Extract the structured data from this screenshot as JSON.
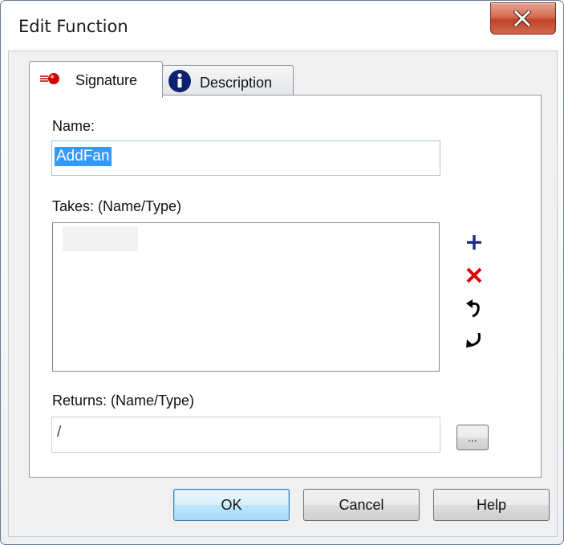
{
  "window": {
    "title": "Edit Function",
    "close_label": "Close"
  },
  "tabs": [
    {
      "label": "Signature",
      "icon": "red-ball-icon",
      "active": true
    },
    {
      "label": "Description",
      "icon": "info-icon",
      "active": false
    }
  ],
  "signature": {
    "name_label": "Name:",
    "name_value": "AddFan",
    "takes_label": "Takes: (Name/Type)",
    "takes_items": [],
    "returns_label": "Returns: (Name/Type)",
    "returns_value": "/",
    "browse_label": "...",
    "list_actions": [
      {
        "name": "add-icon",
        "color": "#1f2d8a"
      },
      {
        "name": "delete-icon",
        "color": "#e00000"
      },
      {
        "name": "move-up-icon",
        "color": "#000000"
      },
      {
        "name": "move-down-icon",
        "color": "#000000"
      }
    ]
  },
  "buttons": {
    "ok": "OK",
    "cancel": "Cancel",
    "help": "Help"
  },
  "colors": {
    "selection": "#3399ff",
    "close_button": "#c24227",
    "default_button_border": "#3c7fb1"
  }
}
